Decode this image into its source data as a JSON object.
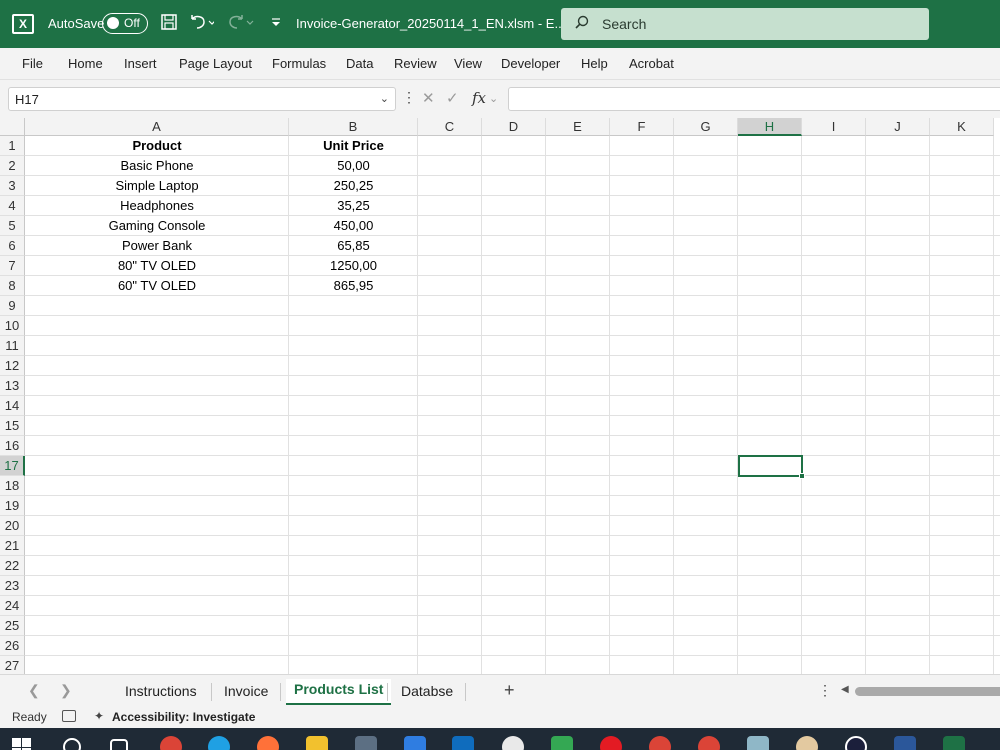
{
  "titlebar": {
    "autosave_label": "AutoSave",
    "autosave_state": "Off",
    "filename": "Invoice-Generator_20250114_1_EN.xlsm  -  E...",
    "search_placeholder": "Search",
    "accent_color": "#1e7145"
  },
  "ribbon": {
    "tabs": [
      "File",
      "Home",
      "Insert",
      "Page Layout",
      "Formulas",
      "Data",
      "Review",
      "View",
      "Developer",
      "Help",
      "Acrobat"
    ]
  },
  "formula_bar": {
    "name_box": "H17",
    "fx_label": "fx",
    "formula": ""
  },
  "grid": {
    "columns": [
      "A",
      "B",
      "C",
      "D",
      "E",
      "F",
      "G",
      "H",
      "I",
      "J",
      "K"
    ],
    "selected_column": "H",
    "rows": [
      "1",
      "2",
      "3",
      "4",
      "5",
      "6",
      "7",
      "8",
      "9",
      "10",
      "11",
      "12",
      "13",
      "14",
      "15",
      "16",
      "17",
      "18",
      "19",
      "20",
      "21",
      "22",
      "23",
      "24",
      "25",
      "26",
      "27"
    ],
    "selected_row": "17",
    "header": {
      "product": "Product",
      "unit_price": "Unit Price"
    },
    "products": [
      {
        "name": "Basic Phone",
        "price": "50,00"
      },
      {
        "name": "Simple Laptop",
        "price": "250,25"
      },
      {
        "name": "Headphones",
        "price": "35,25"
      },
      {
        "name": "Gaming Console",
        "price": "450,00"
      },
      {
        "name": "Power Bank",
        "price": "65,85"
      },
      {
        "name": "80\" TV OLED",
        "price": "1250,00"
      },
      {
        "name": "60\" TV OLED",
        "price": "865,95"
      }
    ]
  },
  "sheets": {
    "tabs": [
      "Instructions",
      "Invoice",
      "Products List",
      "Databse"
    ],
    "active": "Products List"
  },
  "status": {
    "ready": "Ready",
    "accessibility": "Accessibility: Investigate"
  }
}
